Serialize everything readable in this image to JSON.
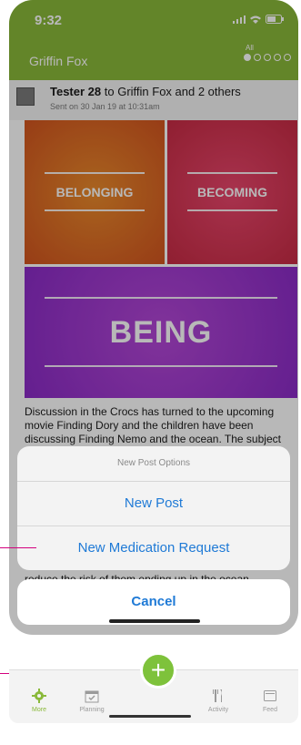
{
  "status_bar": {
    "time": "9:32"
  },
  "nav": {
    "title": "Griffin Fox",
    "filter_label": "All",
    "page_dots": 5,
    "active_dot": 0
  },
  "post": {
    "author": "Tester 28",
    "recipients": " to Griffin Fox and 2 others",
    "sent": "Sent on 30 Jan 19 at 10:31am",
    "image_tiles": [
      "BELONGING",
      "BECOMING",
      "BEING"
    ],
    "body_text": "Discussion in the Crocs has turned to the upcoming movie Finding Dory and the children have been discussing Finding Nemo and the ocean. The subject",
    "body_text_continued": "reduce the risk of them ending up in the ocean."
  },
  "action_sheet": {
    "title": "New Post Options",
    "options": [
      "New Post",
      "New Medication Request"
    ],
    "cancel": "Cancel"
  },
  "tab_bar": {
    "items": [
      {
        "label": "More",
        "icon": "gear-icon",
        "active": true
      },
      {
        "label": "Planning",
        "icon": "calendar-icon",
        "active": false
      },
      {
        "label": "Activity",
        "icon": "utensils-icon",
        "active": false
      },
      {
        "label": "Feed",
        "icon": "feed-icon",
        "active": false
      }
    ],
    "fab_icon": "plus-icon"
  },
  "colors": {
    "brand_green": "#8ab93a",
    "action_blue": "#1f7ad6",
    "annotation_pink": "#d3007d"
  }
}
